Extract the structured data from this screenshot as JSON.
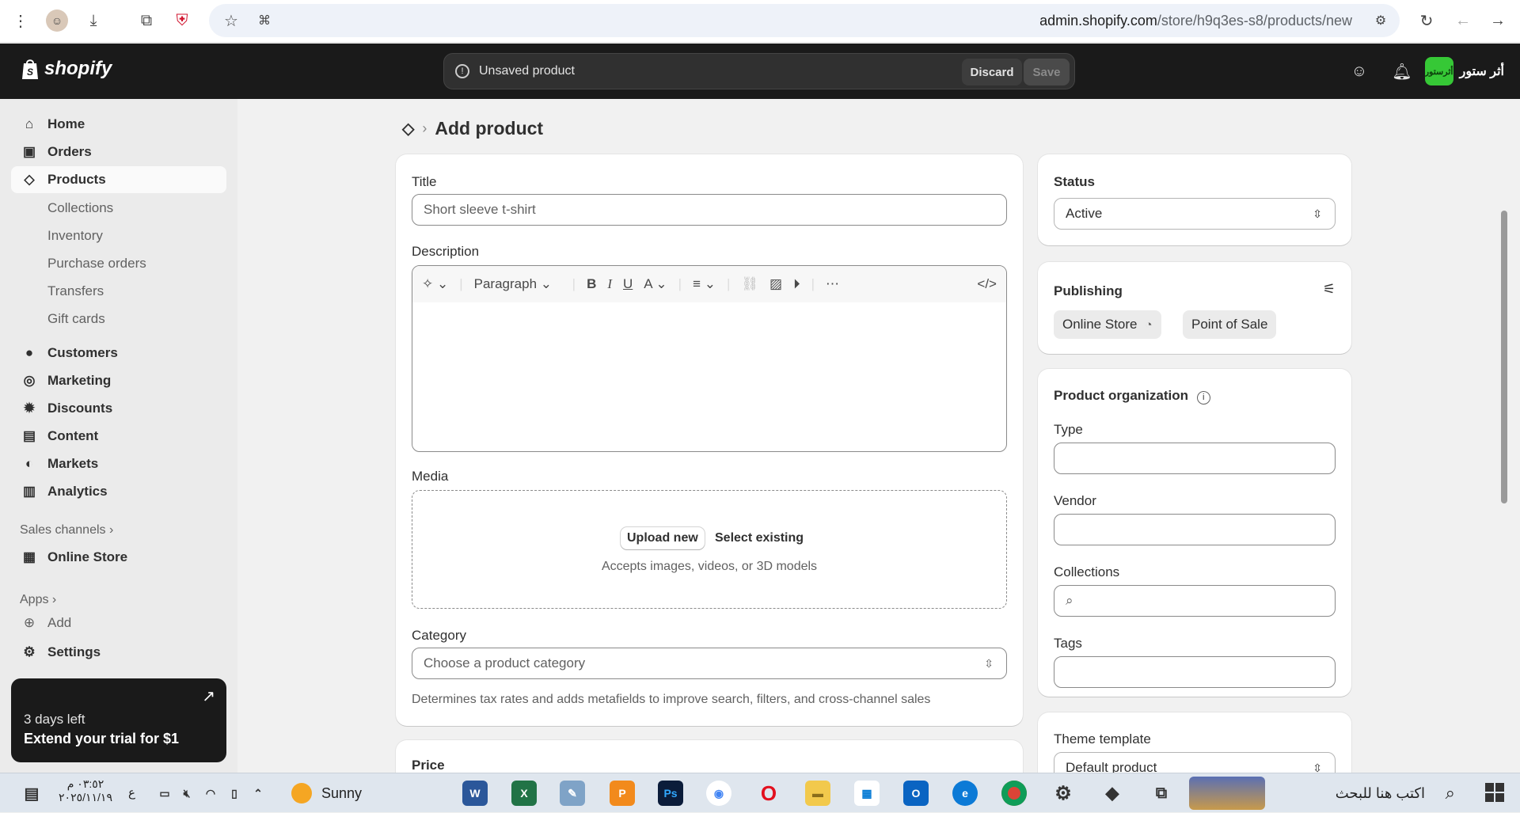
{
  "browser": {
    "url_host": "admin.shopify.com",
    "url_path": "/store/h9q3es-s8/products/new"
  },
  "topbar": {
    "logo_text": "shopify",
    "unsaved_label": "Unsaved product",
    "discard_label": "Discard",
    "save_label": "Save",
    "store_name": "أثر ستور",
    "store_avatar": "أثرستور"
  },
  "sidebar": {
    "items": [
      {
        "label": "Home",
        "icon": "home-icon"
      },
      {
        "label": "Orders",
        "icon": "inbox-icon"
      },
      {
        "label": "Products",
        "icon": "tag-icon"
      }
    ],
    "product_subitems": [
      "Collections",
      "Inventory",
      "Purchase orders",
      "Transfers",
      "Gift cards"
    ],
    "items2": [
      {
        "label": "Customers",
        "icon": "person-icon"
      },
      {
        "label": "Marketing",
        "icon": "target-icon"
      },
      {
        "label": "Discounts",
        "icon": "discount-icon"
      },
      {
        "label": "Content",
        "icon": "image-icon"
      },
      {
        "label": "Markets",
        "icon": "globe-icon"
      },
      {
        "label": "Analytics",
        "icon": "bar-chart-icon"
      }
    ],
    "sales_channels_label": "Sales channels",
    "online_store_label": "Online Store",
    "apps_label": "Apps",
    "add_label": "Add",
    "settings_label": "Settings",
    "trial_days": "3 days left",
    "trial_cta": "Extend your trial for $1"
  },
  "page": {
    "title": "Add product",
    "title_label": "Title",
    "title_placeholder": "Short sleeve t-shirt",
    "description_label": "Description",
    "paragraph_label": "Paragraph",
    "media_label": "Media",
    "upload_new": "Upload new",
    "select_existing": "Select existing",
    "media_hint": "Accepts images, videos, or 3D models",
    "category_label": "Category",
    "category_placeholder": "Choose a product category",
    "category_hint": "Determines tax rates and adds metafields to improve search, filters, and cross-channel sales",
    "price_label": "Price"
  },
  "right": {
    "status_label": "Status",
    "status_value": "Active",
    "publishing_label": "Publishing",
    "channels": [
      "Online Store",
      "Point of Sale"
    ],
    "org_label": "Product organization",
    "type_label": "Type",
    "vendor_label": "Vendor",
    "collections_label": "Collections",
    "tags_label": "Tags",
    "theme_label": "Theme template",
    "theme_value": "Default product"
  },
  "taskbar": {
    "weather": "Sunny",
    "time": "٠٣:٥٢ م",
    "date": "٢٠٢٥/١١/١٩",
    "search_placeholder": "اكتب هنا للبحث",
    "lang": "ع"
  },
  "colors": {
    "topbar": "#1a1a1a",
    "page_bg": "#f1f1f1",
    "store_avatar": "#36c836"
  }
}
